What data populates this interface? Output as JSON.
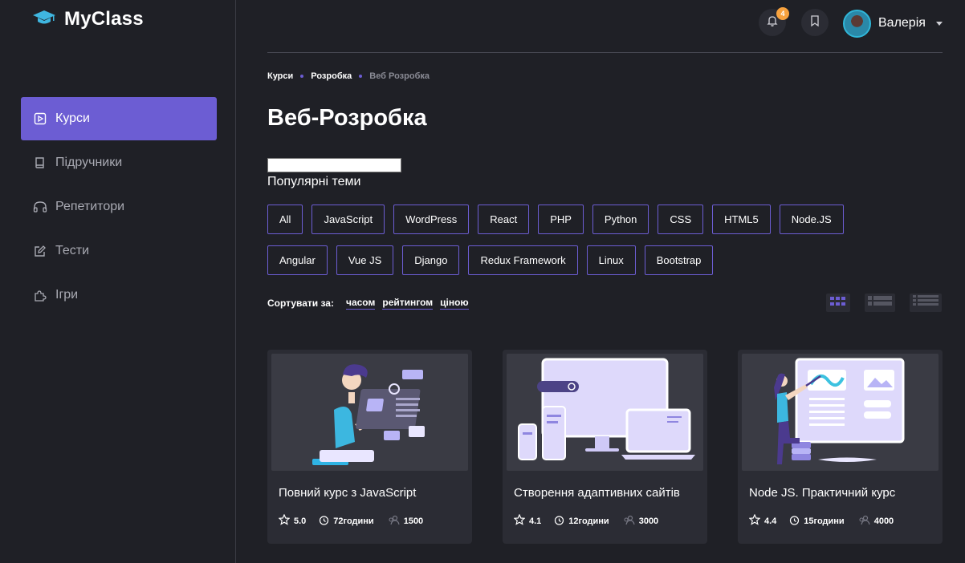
{
  "app": {
    "title": "MyClass"
  },
  "sidebar": {
    "items": [
      {
        "label": "Курси",
        "icon": "play-square-icon",
        "active": true
      },
      {
        "label": "Підручники",
        "icon": "book-icon",
        "active": false
      },
      {
        "label": "Репетитори",
        "icon": "headphones-icon",
        "active": false
      },
      {
        "label": "Тести",
        "icon": "edit-icon",
        "active": false
      },
      {
        "label": "Ігри",
        "icon": "puzzle-icon",
        "active": false
      }
    ]
  },
  "header": {
    "notifications_count": "4",
    "user_name": "Валерія"
  },
  "breadcrumb": [
    "Курси",
    "Розробка",
    "Веб Розробка"
  ],
  "page_title": "Веб-Розробка",
  "popular_label": "Популярні теми",
  "tags_row1": [
    "All",
    "JavaScript",
    "WordPress",
    "React",
    "PHP",
    "Python",
    "CSS",
    "HTML5",
    "Node.JS"
  ],
  "tags_row2": [
    "Angular",
    "Vue JS",
    "Django",
    "Redux Framework",
    "Linux",
    "Bootstrap"
  ],
  "sort": {
    "label": "Сортувати за:",
    "options": [
      "часом",
      "рейтингом",
      "ціною"
    ]
  },
  "cards": [
    {
      "title": "Повний курс з JavaScript",
      "rating": "5.0",
      "duration": "72години",
      "students": "1500"
    },
    {
      "title": "Створення адаптивних сайтів",
      "rating": "4.1",
      "duration": "12години",
      "students": "3000"
    },
    {
      "title": "Node JS. Практичний курс",
      "rating": "4.4",
      "duration": "15години",
      "students": "4000"
    }
  ],
  "colors": {
    "accent": "#6c5dd3",
    "background": "#1f2026",
    "card": "#2b2c34",
    "badge": "#f8a23e"
  }
}
